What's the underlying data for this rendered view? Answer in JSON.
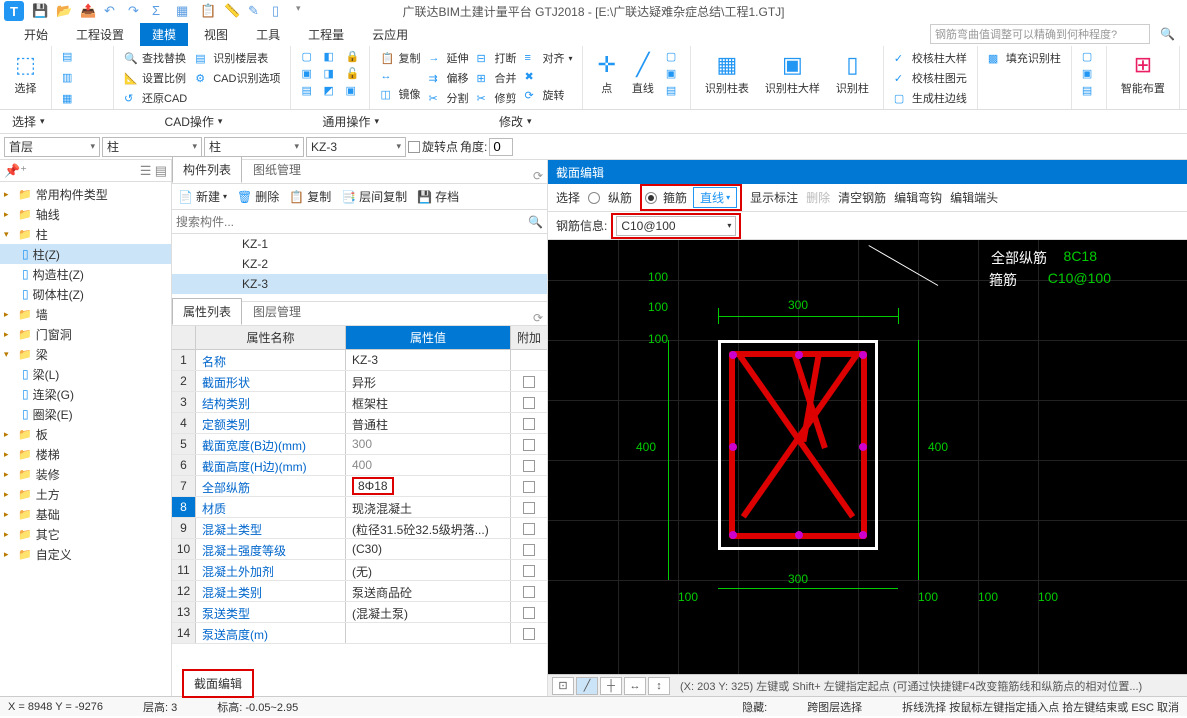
{
  "title": "广联达BIM土建计量平台 GTJ2018 - [E:\\广联达疑难杂症总结\\工程1.GTJ]",
  "menus": [
    "开始",
    "工程设置",
    "建模",
    "视图",
    "工具",
    "工程量",
    "云应用"
  ],
  "search_placeholder": "钢筋弯曲值调整可以精确到何种程度?",
  "ribbon": {
    "select": "选择",
    "cad_ops_label": "CAD操作",
    "general_ops_label": "通用操作",
    "modify_label": "修改",
    "g1": {
      "find_replace": "查找替换",
      "set_scale": "设置比例",
      "restore_cad": "还原CAD",
      "identify_floor": "识别楼层表",
      "cad_identify": "CAD识别选项"
    },
    "g3": {
      "copy": "复制",
      "mirror": "镜像",
      "extend": "延伸",
      "offset": "偏移",
      "align": "对齐",
      "merge": "合并",
      "trim": "修剪",
      "break": "打断",
      "split": "分割",
      "rotate": "旋转"
    },
    "g4": {
      "point": "点",
      "line": "直线"
    },
    "g5": {
      "identify_col": "识别柱表",
      "identify_col_big": "识别柱大样",
      "identify_col2": "识别柱"
    },
    "g6": {
      "check_col_big": "校核柱大样",
      "check_col_img": "校核柱图元",
      "fill_identify": "填充识别柱",
      "gen_col_edge": "生成柱边线"
    },
    "g7": {
      "smart_layout": "智能布置"
    }
  },
  "sub": {
    "floor": "首层",
    "t1": "柱",
    "t2": "柱",
    "t3": "KZ-3",
    "rot_pt": "旋转点",
    "angle": "角度:",
    "angle_val": "0"
  },
  "tree": [
    {
      "l": "常用构件类型",
      "t": "cat"
    },
    {
      "l": "轴线",
      "t": "cat"
    },
    {
      "l": "柱",
      "t": "cat",
      "open": true
    },
    {
      "l": "柱(Z)",
      "t": "item",
      "sel": true
    },
    {
      "l": "构造柱(Z)",
      "t": "item"
    },
    {
      "l": "砌体柱(Z)",
      "t": "item"
    },
    {
      "l": "墙",
      "t": "cat"
    },
    {
      "l": "门窗洞",
      "t": "cat"
    },
    {
      "l": "梁",
      "t": "cat",
      "open": true
    },
    {
      "l": "梁(L)",
      "t": "item"
    },
    {
      "l": "连梁(G)",
      "t": "item"
    },
    {
      "l": "圈梁(E)",
      "t": "item"
    },
    {
      "l": "板",
      "t": "cat"
    },
    {
      "l": "楼梯",
      "t": "cat"
    },
    {
      "l": "装修",
      "t": "cat"
    },
    {
      "l": "土方",
      "t": "cat"
    },
    {
      "l": "基础",
      "t": "cat"
    },
    {
      "l": "其它",
      "t": "cat"
    },
    {
      "l": "自定义",
      "t": "cat"
    }
  ],
  "mid": {
    "tab1": "构件列表",
    "tab2": "图纸管理",
    "new": "新建",
    "del": "删除",
    "copy": "复制",
    "layer_copy": "层间复制",
    "archive": "存档",
    "search_ph": "搜索构件...",
    "comps": [
      "KZ-1",
      "KZ-2",
      "KZ-3"
    ],
    "prop_tab1": "属性列表",
    "prop_tab2": "图层管理",
    "h_name": "属性名称",
    "h_val": "属性值",
    "h_add": "附加",
    "rows": [
      {
        "n": "名称",
        "v": "KZ-3"
      },
      {
        "n": "截面形状",
        "v": "异形"
      },
      {
        "n": "结构类别",
        "v": "框架柱"
      },
      {
        "n": "定额类别",
        "v": "普通柱"
      },
      {
        "n": "截面宽度(B边)(mm)",
        "v": "300",
        "gray": true
      },
      {
        "n": "截面高度(H边)(mm)",
        "v": "400",
        "gray": true
      },
      {
        "n": "全部纵筋",
        "v": "8Φ18",
        "hl": true
      },
      {
        "n": "材质",
        "v": "现浇混凝土",
        "sel": true
      },
      {
        "n": "混凝土类型",
        "v": "(粒径31.5砼32.5级坍落...)"
      },
      {
        "n": "混凝土强度等级",
        "v": "(C30)"
      },
      {
        "n": "混凝土外加剂",
        "v": "(无)"
      },
      {
        "n": "混凝土类别",
        "v": "泵送商品砼"
      },
      {
        "n": "泵送类型",
        "v": "(混凝土泵)"
      },
      {
        "n": "泵送高度(m)",
        "v": ""
      }
    ],
    "section_edit": "截面编辑"
  },
  "right": {
    "title": "截面编辑",
    "sel": "选择",
    "long": "纵筋",
    "stirrup": "箍筋",
    "line": "直线",
    "show_anno": "显示标注",
    "del": "删除",
    "clear": "清空钢筋",
    "edit_hook": "编辑弯钩",
    "edit_end": "编辑端头",
    "info_label": "钢筋信息:",
    "info_val": "C10@100",
    "anno_all": "全部纵筋",
    "anno_8c18": "8C18",
    "anno_stirrup": "箍筋",
    "anno_c10": "C10@100",
    "dims": {
      "w": "300",
      "h": "400",
      "seg": "100"
    },
    "footer_hint": "(X: 203 Y: 325)  左键或 Shift+ 左键指定起点 (可通过快捷键F4改变箍筋线和纵筋点的相对位置...)"
  },
  "status": {
    "xy": "X = 8948 Y = -9276",
    "floor": "层高:    3",
    "elev": "标高:    -0.05~2.95",
    "hide": "隐藏:",
    "cross_sel": "跨图层选择",
    "break_line": "拆线洗择  按鼠标左键指定插入点 拾左键结束或 ESC 取消"
  }
}
